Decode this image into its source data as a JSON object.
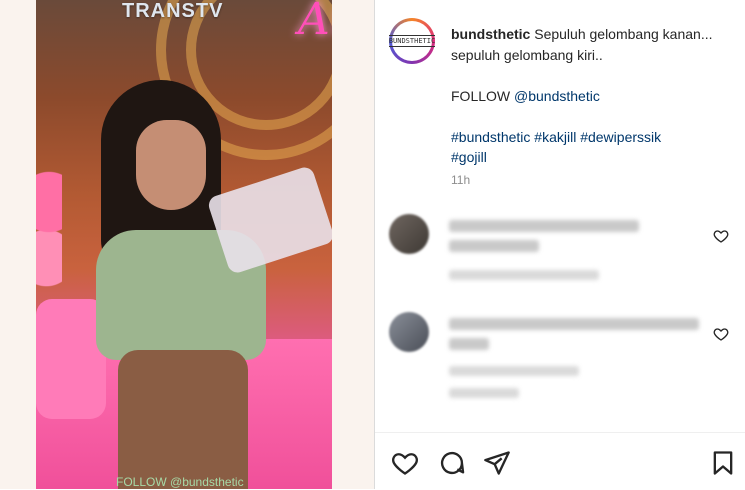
{
  "video": {
    "watermark": "TRANSTV",
    "neon_text": "Ar",
    "bottom_caption": "FOLLOW @bundsthetic"
  },
  "post": {
    "username": "bundsthetic",
    "caption_line1": "Sepuluh gelombang kanan... sepuluh gelombang kiri..",
    "follow_prefix": "FOLLOW ",
    "follow_handle": "@bundsthetic",
    "hashtags": [
      "#bundsthetic",
      "#kakjill",
      "#dewiperssik",
      "#gojill"
    ],
    "time": "11h",
    "avatar_text": "BUNDSTHETIC"
  },
  "icons": {
    "like": "heart-icon",
    "comment": "comment-icon",
    "share": "share-icon",
    "save": "bookmark-icon",
    "comment_like": "heart-icon"
  },
  "colors": {
    "text": "#262626",
    "link": "#00376b",
    "muted": "#8e8e8e"
  }
}
